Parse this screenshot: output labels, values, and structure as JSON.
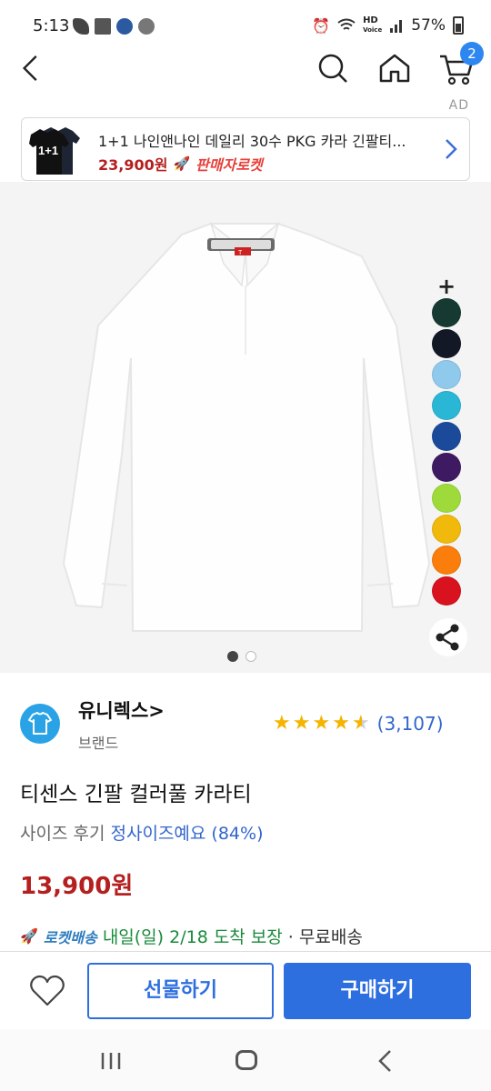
{
  "status_bar": {
    "time": "5:13",
    "hd": "HD",
    "voice": "Voice",
    "battery": "57%"
  },
  "header": {
    "icons": [
      "back-arrow-icon",
      "search-icon",
      "home-icon",
      "cart-icon"
    ],
    "cart_count": "2",
    "ad_label": "AD"
  },
  "ad_banner": {
    "title": "1+1 나인앤나인 데일리 30수 PKG 카라 긴팔티...",
    "thumb_text": "1+1",
    "price": "23,900원",
    "badge": "판매자로켓"
  },
  "gallery": {
    "shirt_label": "T",
    "color_swatches": [
      "#163a31",
      "#121826",
      "#8fc9ec",
      "#2ab7d6",
      "#1c4a9a",
      "#3e1a63",
      "#9edb3a",
      "#f0b90b",
      "#fb7d0b",
      "#d8121f"
    ],
    "plus": "+",
    "page_count": 2,
    "current_page": 1
  },
  "brand": {
    "name": "유니렉스>",
    "subtitle": "브랜드",
    "rating": 4.5,
    "review_count": "(3,107)"
  },
  "product": {
    "title": "티센스 긴팔 컬러풀 카라티",
    "size_review_label": "사이즈 후기",
    "size_review_value": "정사이즈예요 (84%)",
    "price": "13,900원",
    "delivery_badge": "로켓배송",
    "delivery_date": "내일(일) 2/18 도착 보장",
    "delivery_free": "· 무료배송"
  },
  "actions": {
    "gift_label": "선물하기",
    "buy_label": "구매하기"
  },
  "colors": {
    "accent_blue": "#2e6fe0",
    "price_red": "#b51f1f",
    "rating_star": "#f4b400",
    "link_blue": "#3366cc",
    "delivery_green": "#1a8a3c"
  }
}
